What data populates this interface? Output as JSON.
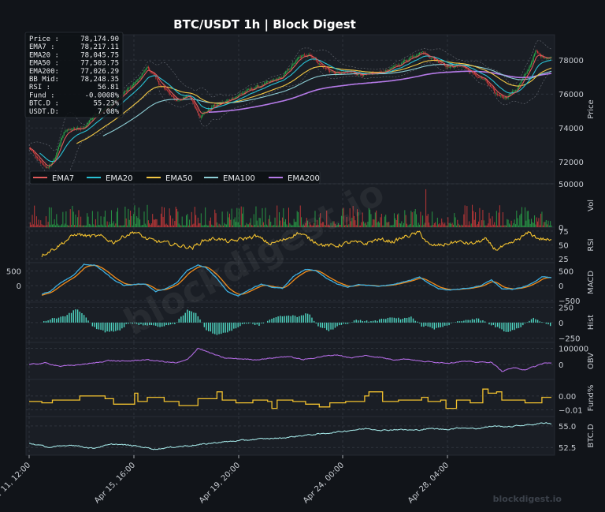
{
  "chart_data": {
    "type": "line",
    "title": "BTC/USDT  1h  |  Block Digest",
    "watermark": "blockdigest.io",
    "footer_brand": "blockdigest.io",
    "colors": {
      "background": "#111419",
      "panel": "#1a1e25",
      "grid": "#3a404a",
      "text": "#c8ccd2",
      "title": "#ffffff",
      "up": "#2aa84a",
      "down": "#d63b3b",
      "ema7": "#e05a5a",
      "ema20": "#29c1d4",
      "ema50": "#f2c744",
      "ema100": "#8ecfd6",
      "ema200": "#b57ae8",
      "rsi": "#f2c12e",
      "macd": "#3daee0",
      "signal": "#f28c1b",
      "hist": "#4fd6c2",
      "obv": "#b06ae0",
      "fund": "#f2c12e",
      "btcd": "#9fe0e0",
      "bollinger": "#8a8f99"
    },
    "info_box": [
      {
        "label": "Price  :",
        "value": "78,174.90"
      },
      {
        "label": "EMA7   :",
        "value": "78,217.11"
      },
      {
        "label": "EMA20  :",
        "value": "78,045.75"
      },
      {
        "label": "EMA50  :",
        "value": "77,503.75"
      },
      {
        "label": "EMA200:",
        "value": "77,026.29"
      },
      {
        "label": "BB Mid:",
        "value": "78,248.35"
      },
      {
        "label": "RSI    :",
        "value": "56.81"
      },
      {
        "label": "Fund   :",
        "value": "-0.0008%"
      },
      {
        "label": "BTC.D  :",
        "value": "55.23%"
      },
      {
        "label": "USDT.D:",
        "value": "7.08%"
      }
    ],
    "legend": [
      "EMA7",
      "EMA20",
      "EMA50",
      "EMA100",
      "EMA200"
    ],
    "x_tick_labels": [
      "Apr 11, 12:00",
      "Apr 15, 16:00",
      "Apr 19, 20:00",
      "Apr 24, 00:00",
      "Apr 28, 04:00"
    ],
    "panels": [
      {
        "id": "price",
        "ylabel": "Price",
        "ticks": [
          "72000",
          "74000",
          "76000",
          "78000"
        ],
        "ylim": [
          70700,
          79500
        ]
      },
      {
        "id": "vol",
        "ylabel": "Vol",
        "ticks": [
          "0",
          "50000"
        ],
        "ylim": [
          0,
          50000
        ]
      },
      {
        "id": "rsi",
        "ylabel": "RSI",
        "ticks": [
          "25",
          "50",
          "75"
        ],
        "ylim": [
          18,
          82
        ]
      },
      {
        "id": "macd",
        "ylabel": "MACD",
        "ticks": [
          "−500",
          "0",
          "500"
        ],
        "left_ticks": [
          "0",
          "500"
        ],
        "ylim": [
          -560,
          780
        ]
      },
      {
        "id": "hist",
        "ylabel": "Hist",
        "ticks": [
          "−250",
          "0",
          "250"
        ],
        "ylim": [
          -320,
          330
        ]
      },
      {
        "id": "obv",
        "ylabel": "OBV",
        "ticks": [
          "0",
          "100000"
        ],
        "ylim": [
          -90000,
          135000
        ]
      },
      {
        "id": "fund",
        "ylabel": "Fund%",
        "ticks": [
          "−0.01",
          "0.00"
        ],
        "ylim": [
          -0.015,
          0.012
        ]
      },
      {
        "id": "btcd",
        "ylabel": "BTC.D",
        "ticks": [
          "52.5",
          "55.0"
        ],
        "ylim": [
          51.6,
          56.1
        ]
      }
    ],
    "series_keypoints": {
      "close": [
        [
          0,
          72800
        ],
        [
          10,
          72000
        ],
        [
          18,
          71600
        ],
        [
          25,
          72300
        ],
        [
          33,
          73800
        ],
        [
          40,
          73900
        ],
        [
          52,
          74000
        ],
        [
          62,
          74800
        ],
        [
          75,
          75200
        ],
        [
          85,
          75800
        ],
        [
          100,
          76600
        ],
        [
          112,
          77600
        ],
        [
          125,
          76500
        ],
        [
          140,
          75600
        ],
        [
          152,
          75900
        ],
        [
          162,
          74700
        ],
        [
          175,
          75300
        ],
        [
          188,
          75600
        ],
        [
          200,
          76000
        ],
        [
          215,
          76400
        ],
        [
          228,
          76700
        ],
        [
          240,
          77000
        ],
        [
          255,
          78100
        ],
        [
          265,
          78400
        ],
        [
          278,
          77600
        ],
        [
          290,
          77200
        ],
        [
          305,
          77300
        ],
        [
          320,
          77100
        ],
        [
          335,
          77300
        ],
        [
          350,
          77700
        ],
        [
          362,
          78200
        ],
        [
          372,
          78500
        ],
        [
          385,
          78000
        ],
        [
          398,
          77600
        ],
        [
          410,
          77700
        ],
        [
          420,
          77200
        ],
        [
          432,
          76800
        ],
        [
          442,
          76000
        ],
        [
          452,
          75800
        ],
        [
          462,
          76300
        ],
        [
          472,
          77300
        ],
        [
          480,
          78500
        ],
        [
          486,
          78200
        ],
        [
          492,
          78150
        ],
        [
          495,
          78174.9
        ]
      ],
      "rsi": [
        [
          0,
          25
        ],
        [
          12,
          32
        ],
        [
          25,
          45
        ],
        [
          38,
          62
        ],
        [
          45,
          70
        ],
        [
          55,
          66
        ],
        [
          68,
          65
        ],
        [
          80,
          55
        ],
        [
          92,
          68
        ],
        [
          100,
          74
        ],
        [
          112,
          60
        ],
        [
          125,
          55
        ],
        [
          140,
          50
        ],
        [
          155,
          45
        ],
        [
          165,
          58
        ],
        [
          178,
          62
        ],
        [
          190,
          55
        ],
        [
          200,
          60
        ],
        [
          215,
          66
        ],
        [
          228,
          52
        ],
        [
          240,
          58
        ],
        [
          255,
          72
        ],
        [
          265,
          62
        ],
        [
          278,
          50
        ],
        [
          290,
          48
        ],
        [
          305,
          55
        ],
        [
          318,
          52
        ],
        [
          330,
          60
        ],
        [
          345,
          56
        ],
        [
          358,
          66
        ],
        [
          370,
          72
        ],
        [
          380,
          48
        ],
        [
          392,
          50
        ],
        [
          405,
          56
        ],
        [
          420,
          52
        ],
        [
          432,
          60
        ],
        [
          442,
          42
        ],
        [
          455,
          50
        ],
        [
          465,
          62
        ],
        [
          474,
          72
        ],
        [
          482,
          62
        ],
        [
          490,
          60
        ],
        [
          495,
          57
        ]
      ],
      "macd": [
        [
          0,
          -400
        ],
        [
          10,
          -300
        ],
        [
          20,
          -200
        ],
        [
          30,
          100
        ],
        [
          42,
          350
        ],
        [
          52,
          720
        ],
        [
          62,
          700
        ],
        [
          70,
          500
        ],
        [
          80,
          200
        ],
        [
          90,
          0
        ],
        [
          100,
          40
        ],
        [
          110,
          60
        ],
        [
          120,
          -200
        ],
        [
          130,
          -100
        ],
        [
          140,
          100
        ],
        [
          150,
          520
        ],
        [
          160,
          700
        ],
        [
          168,
          600
        ],
        [
          178,
          250
        ],
        [
          188,
          -200
        ],
        [
          198,
          -350
        ],
        [
          208,
          -150
        ],
        [
          220,
          50
        ],
        [
          230,
          -50
        ],
        [
          240,
          -100
        ],
        [
          250,
          300
        ],
        [
          262,
          560
        ],
        [
          272,
          500
        ],
        [
          282,
          250
        ],
        [
          292,
          50
        ],
        [
          302,
          -50
        ],
        [
          312,
          30
        ],
        [
          322,
          10
        ],
        [
          332,
          -20
        ],
        [
          342,
          30
        ],
        [
          352,
          100
        ],
        [
          362,
          200
        ],
        [
          370,
          300
        ],
        [
          378,
          100
        ],
        [
          388,
          -100
        ],
        [
          398,
          -150
        ],
        [
          408,
          -120
        ],
        [
          418,
          -80
        ],
        [
          428,
          0
        ],
        [
          438,
          200
        ],
        [
          448,
          -100
        ],
        [
          458,
          -120
        ],
        [
          468,
          -50
        ],
        [
          478,
          100
        ],
        [
          486,
          300
        ],
        [
          495,
          270
        ]
      ],
      "hist": [
        [
          0,
          0
        ],
        [
          20,
          50
        ],
        [
          35,
          110
        ],
        [
          45,
          220
        ],
        [
          52,
          120
        ],
        [
          60,
          -60
        ],
        [
          72,
          -150
        ],
        [
          85,
          -120
        ],
        [
          95,
          0
        ],
        [
          108,
          -40
        ],
        [
          122,
          -60
        ],
        [
          138,
          -30
        ],
        [
          150,
          200
        ],
        [
          158,
          150
        ],
        [
          168,
          -120
        ],
        [
          178,
          -200
        ],
        [
          190,
          -140
        ],
        [
          205,
          0
        ],
        [
          218,
          -40
        ],
        [
          232,
          70
        ],
        [
          245,
          120
        ],
        [
          255,
          100
        ],
        [
          265,
          150
        ],
        [
          275,
          -80
        ],
        [
          285,
          -130
        ],
        [
          295,
          -40
        ],
        [
          310,
          30
        ],
        [
          325,
          20
        ],
        [
          340,
          80
        ],
        [
          352,
          60
        ],
        [
          362,
          100
        ],
        [
          372,
          -50
        ],
        [
          385,
          -100
        ],
        [
          398,
          -30
        ],
        [
          412,
          40
        ],
        [
          425,
          60
        ],
        [
          440,
          -50
        ],
        [
          452,
          -150
        ],
        [
          465,
          -80
        ],
        [
          478,
          60
        ],
        [
          485,
          30
        ],
        [
          495,
          -60
        ]
      ],
      "obv": [
        [
          0,
          0
        ],
        [
          15,
          10000
        ],
        [
          30,
          -10000
        ],
        [
          48,
          0
        ],
        [
          62,
          10000
        ],
        [
          75,
          25000
        ],
        [
          90,
          20000
        ],
        [
          110,
          30000
        ],
        [
          125,
          20000
        ],
        [
          140,
          10000
        ],
        [
          150,
          30000
        ],
        [
          160,
          100000
        ],
        [
          172,
          70000
        ],
        [
          185,
          40000
        ],
        [
          200,
          35000
        ],
        [
          215,
          30000
        ],
        [
          230,
          40000
        ],
        [
          245,
          50000
        ],
        [
          260,
          30000
        ],
        [
          278,
          50000
        ],
        [
          292,
          60000
        ],
        [
          305,
          40000
        ],
        [
          318,
          55000
        ],
        [
          332,
          45000
        ],
        [
          345,
          30000
        ],
        [
          358,
          35000
        ],
        [
          372,
          20000
        ],
        [
          385,
          15000
        ],
        [
          398,
          10000
        ],
        [
          410,
          20000
        ],
        [
          425,
          15000
        ],
        [
          438,
          15000
        ],
        [
          448,
          -40000
        ],
        [
          458,
          -20000
        ],
        [
          470,
          -30000
        ],
        [
          480,
          -10000
        ],
        [
          488,
          10000
        ],
        [
          495,
          8000
        ]
      ],
      "btcd": [
        [
          0,
          53.0
        ],
        [
          20,
          52.5
        ],
        [
          40,
          52.8
        ],
        [
          60,
          52.4
        ],
        [
          80,
          52.9
        ],
        [
          100,
          52.7
        ],
        [
          120,
          52.3
        ],
        [
          140,
          52.6
        ],
        [
          160,
          52.8
        ],
        [
          180,
          53.1
        ],
        [
          200,
          53.3
        ],
        [
          220,
          53.5
        ],
        [
          240,
          53.6
        ],
        [
          260,
          53.9
        ],
        [
          278,
          54.1
        ],
        [
          292,
          54.3
        ],
        [
          305,
          54.5
        ],
        [
          320,
          54.7
        ],
        [
          335,
          54.5
        ],
        [
          350,
          54.6
        ],
        [
          365,
          54.5
        ],
        [
          380,
          54.7
        ],
        [
          395,
          54.6
        ],
        [
          410,
          54.8
        ],
        [
          425,
          54.7
        ],
        [
          440,
          55.0
        ],
        [
          455,
          54.9
        ],
        [
          468,
          55.1
        ],
        [
          480,
          55.2
        ],
        [
          490,
          55.4
        ],
        [
          495,
          55.23
        ]
      ],
      "fund": [
        [
          0,
          -0.004
        ],
        [
          12,
          -0.005
        ],
        [
          22,
          -0.003
        ],
        [
          48,
          0.0
        ],
        [
          72,
          -0.002
        ],
        [
          80,
          -0.006
        ],
        [
          95,
          -0.006
        ],
        [
          100,
          0.002
        ],
        [
          103,
          -0.004
        ],
        [
          112,
          -0.001
        ],
        [
          128,
          -0.004
        ],
        [
          142,
          -0.007
        ],
        [
          160,
          -0.002
        ],
        [
          178,
          0.003
        ],
        [
          183,
          -0.003
        ],
        [
          196,
          -0.005
        ],
        [
          212,
          -0.003
        ],
        [
          226,
          -0.004
        ],
        [
          230,
          -0.009
        ],
        [
          235,
          -0.003
        ],
        [
          250,
          -0.004
        ],
        [
          262,
          -0.006
        ],
        [
          275,
          -0.008
        ],
        [
          285,
          -0.005
        ],
        [
          300,
          -0.004
        ],
        [
          318,
          0.0
        ],
        [
          322,
          0.003
        ],
        [
          335,
          -0.004
        ],
        [
          350,
          -0.003
        ],
        [
          372,
          -0.001
        ],
        [
          378,
          -0.004
        ],
        [
          390,
          -0.003
        ],
        [
          395,
          -0.009
        ],
        [
          405,
          -0.003
        ],
        [
          418,
          -0.005
        ],
        [
          430,
          0.005
        ],
        [
          435,
          0.002
        ],
        [
          443,
          0.003
        ],
        [
          448,
          -0.003
        ],
        [
          470,
          -0.005
        ],
        [
          486,
          -0.001
        ],
        [
          495,
          -0.001
        ]
      ]
    }
  }
}
